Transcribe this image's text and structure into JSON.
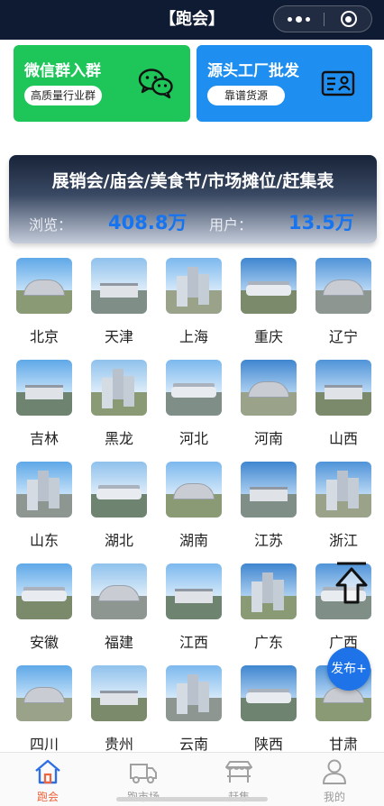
{
  "nav": {
    "title": "【跑会】"
  },
  "promos": [
    {
      "title": "微信群入群",
      "tag": "高质量行业群",
      "icon": "wechat-icon",
      "color": "#1ec65a"
    },
    {
      "title": "源头工厂批发",
      "tag": "靠谱货源",
      "icon": "id-card-icon",
      "color": "#1e8ff0"
    }
  ],
  "stats": {
    "title": "展销会/庙会/美食节/市场摊位/赶集表",
    "views_label": "浏览：",
    "views_value": "408.8万",
    "users_label": "用户：",
    "users_value": "13.5万",
    "value_color": "#1774f0"
  },
  "provinces": [
    "北京",
    "天津",
    "上海",
    "重庆",
    "辽宁",
    "吉林",
    "黑龙",
    "河北",
    "河南",
    "山西",
    "山东",
    "湖北",
    "湖南",
    "江苏",
    "浙江",
    "安徽",
    "福建",
    "江西",
    "广东",
    "广西",
    "四川",
    "贵州",
    "云南",
    "陕西",
    "甘肃"
  ],
  "fab": {
    "label": "发布+"
  },
  "tabs": [
    {
      "label": "跑会",
      "icon": "home-icon",
      "active": true
    },
    {
      "label": "跑市场",
      "icon": "truck-icon",
      "active": false
    },
    {
      "label": "赶集",
      "icon": "market-stall-icon",
      "active": false
    },
    {
      "label": "我的",
      "icon": "user-icon",
      "active": false
    }
  ],
  "colors": {
    "nav_bg": "#0f1b33",
    "active_tab": "#f0633c",
    "fab": "#1e73e8"
  }
}
